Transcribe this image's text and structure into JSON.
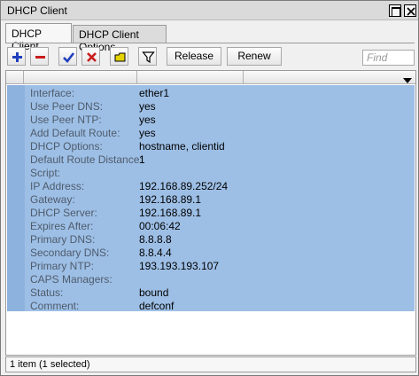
{
  "window": {
    "title": "DHCP Client"
  },
  "tabs": [
    {
      "label": "DHCP Client"
    },
    {
      "label": "DHCP Client Options"
    }
  ],
  "toolbar": {
    "icons": [
      "add-icon",
      "remove-icon",
      "enable-icon",
      "disable-icon",
      "comment-icon",
      "filter-icon"
    ],
    "release_label": "Release",
    "renew_label": "Renew",
    "find_placeholder": "Find"
  },
  "colors": {
    "selection": "#9dbfe6",
    "label_text": "#4f5b6b",
    "add": "#1f3fbf",
    "remove": "#c81d1d",
    "enable": "#1f3fbf",
    "disable": "#c81d1d",
    "comment": "#e4d300"
  },
  "details": [
    {
      "key": "Interface:",
      "value": "ether1"
    },
    {
      "key": "Use Peer DNS:",
      "value": "yes"
    },
    {
      "key": "Use Peer NTP:",
      "value": "yes"
    },
    {
      "key": "Add Default Route:",
      "value": "yes"
    },
    {
      "key": "DHCP Options:",
      "value": "hostname, clientid"
    },
    {
      "key": "Default Route Distance:",
      "value": "1"
    },
    {
      "key": "Script:",
      "value": ""
    },
    {
      "key": "IP Address:",
      "value": "192.168.89.252/24"
    },
    {
      "key": "Gateway:",
      "value": "192.168.89.1"
    },
    {
      "key": "DHCP Server:",
      "value": "192.168.89.1"
    },
    {
      "key": "Expires After:",
      "value": "00:06:42"
    },
    {
      "key": "Primary DNS:",
      "value": "8.8.8.8"
    },
    {
      "key": "Secondary DNS:",
      "value": "8.8.4.4"
    },
    {
      "key": "Primary NTP:",
      "value": "193.193.193.107"
    },
    {
      "key": "CAPS Managers:",
      "value": ""
    },
    {
      "key": "Status:",
      "value": "bound"
    },
    {
      "key": "Comment:",
      "value": "defconf"
    }
  ],
  "status": {
    "text": "1 item (1 selected)"
  }
}
